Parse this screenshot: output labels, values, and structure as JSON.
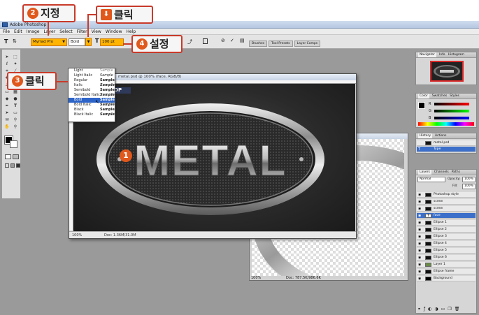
{
  "window": {
    "title": "Adobe Photoshop"
  },
  "menu": [
    "File",
    "Edit",
    "Image",
    "Layer",
    "Select",
    "Filter",
    "View",
    "Window",
    "Help"
  ],
  "options_bar": {
    "font_family": "Myriad Pro",
    "font_style": "Bold",
    "font_size": "100 pt",
    "tool_letter": "T",
    "palette_tabs": [
      "Brushes",
      "Tool Presets",
      "Layer Comps"
    ]
  },
  "font_style_menu": {
    "items": [
      {
        "name": "Light",
        "sample": "Sample"
      },
      {
        "name": "Light Italic",
        "sample": "Sample"
      },
      {
        "name": "Regular",
        "sample": "Sample"
      },
      {
        "name": "Italic",
        "sample": "Sample"
      },
      {
        "name": "Semibold",
        "sample": "Sample"
      },
      {
        "name": "Semibold Italic",
        "sample": "Sample"
      },
      {
        "name": "Bold",
        "sample": "Sample"
      },
      {
        "name": "Bold Italic",
        "sample": "Sample"
      },
      {
        "name": "Black",
        "sample": "Sample"
      },
      {
        "name": "Black Italic",
        "sample": "Sample"
      }
    ],
    "selected": "Bold"
  },
  "document_main": {
    "title": "metal.psd @ 100% (face, RGB/8)",
    "zoom": "100%",
    "doc_size": "Doc: 1.36M/31.0M",
    "artwork_text": "METAL",
    "watermark": "OP"
  },
  "document_back": {
    "zoom": "100%",
    "doc_size": "Doc: 787.5K/986.6K"
  },
  "navigator": {
    "tabs": [
      "Navigator",
      "Info",
      "Histogram"
    ]
  },
  "color_panel": {
    "tabs": [
      "Color",
      "Swatches",
      "Styles"
    ],
    "channels": [
      "R",
      "G",
      "B"
    ]
  },
  "history_panel": {
    "tabs": [
      "History",
      "Actions"
    ],
    "items": [
      "metal.psd",
      "Type"
    ]
  },
  "layers_panel": {
    "tabs": [
      "Layers",
      "Channels",
      "Paths"
    ],
    "blend_mode": "Normal",
    "opacity_label": "Opacity:",
    "opacity": "100%",
    "fill_label": "Fill:",
    "fill": "100%",
    "layers": [
      {
        "name": "Photoshop style",
        "selected": false
      },
      {
        "name": "screw",
        "selected": false
      },
      {
        "name": "screw",
        "selected": false
      },
      {
        "name": "face",
        "selected": true
      },
      {
        "name": "Ellipse 1",
        "selected": false
      },
      {
        "name": "Ellipse 2",
        "selected": false
      },
      {
        "name": "Ellipse 3",
        "selected": false
      },
      {
        "name": "Ellipse 4",
        "selected": false
      },
      {
        "name": "Ellipse 5",
        "selected": false
      },
      {
        "name": "Ellipse 6",
        "selected": false
      },
      {
        "name": "Layer 1",
        "selected": false
      },
      {
        "name": "Ellipse frame",
        "selected": false
      },
      {
        "name": "Background",
        "selected": false
      }
    ]
  },
  "annotations": {
    "step2": {
      "num": "2",
      "label": "지정"
    },
    "click_top": {
      "label": "클릭"
    },
    "step3": {
      "num": "3",
      "label": "클릭"
    },
    "step4": {
      "num": "4",
      "label": "설정"
    },
    "step1": {
      "num": "1"
    }
  }
}
